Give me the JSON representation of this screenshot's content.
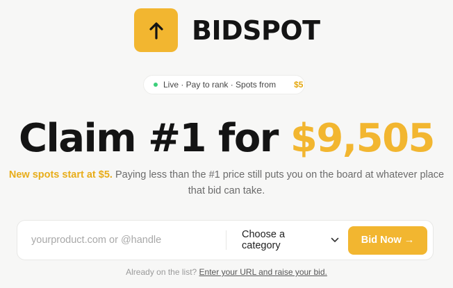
{
  "brand": {
    "name": "BIDSPOT",
    "logo_icon": "arrow-up-icon",
    "accent_color": "#f2b630"
  },
  "badge": {
    "text": "Live · Pay to rank · Spots from",
    "price": "$5",
    "dot_color": "#3ccf7a"
  },
  "headline": {
    "prefix": "Claim #1 for",
    "price": "$9,505"
  },
  "subtitle": {
    "highlight": "New spots start at $5.",
    "text": "Paying less than the #1 price still puts you on the board at whatever place that bid can take."
  },
  "form": {
    "url_placeholder": "yourproduct.com or @handle",
    "url_value": "",
    "category_label": "Choose a category",
    "category_icon": "chevron-down-icon",
    "submit_label": "Bid Now →"
  },
  "footer": {
    "prefix": "Already on the list?",
    "link_text": "Enter your URL and raise your bid."
  }
}
